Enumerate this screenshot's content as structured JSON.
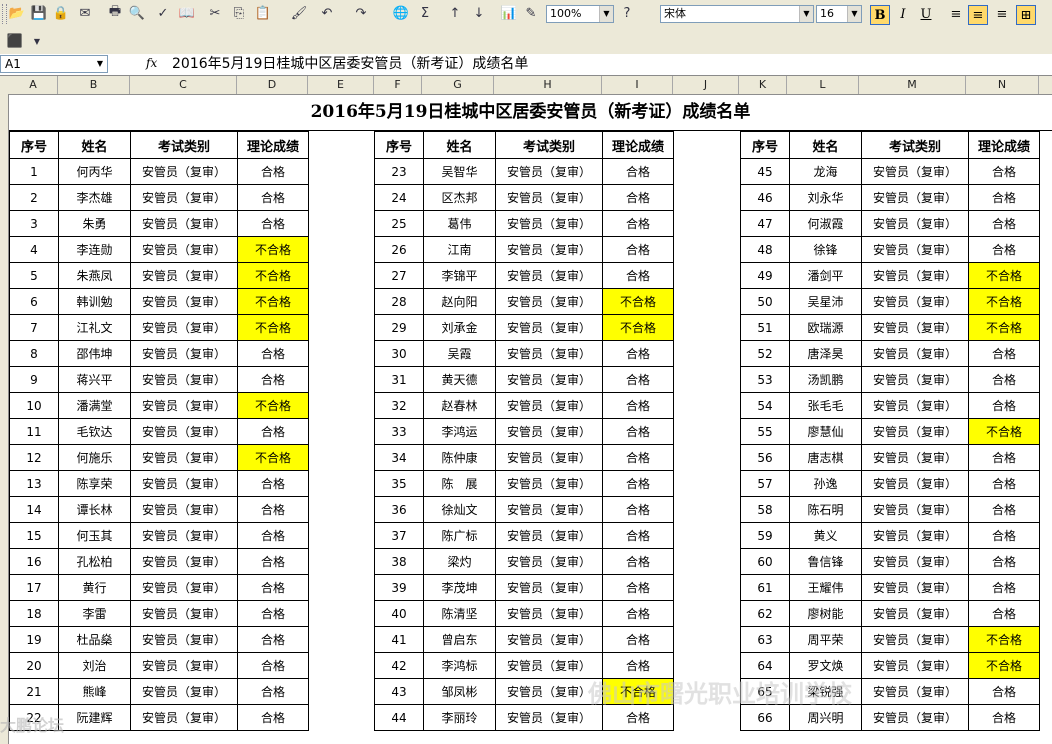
{
  "toolbar": {
    "zoom": "100%",
    "font_name": "宋体",
    "font_size": "16"
  },
  "formula_bar": {
    "cell_ref": "A1",
    "fx_label": "fx",
    "content": "2016年5月19日桂城中区居委安管员（新考证）成绩名单"
  },
  "columns": [
    "A",
    "B",
    "C",
    "D",
    "E",
    "F",
    "G",
    "H",
    "I",
    "J",
    "K",
    "L",
    "M",
    "N"
  ],
  "sheet": {
    "title": "2016年5月19日桂城中区居委安管员（新考证）成绩名单",
    "headers": [
      "序号",
      "姓名",
      "考试类别",
      "理论成绩"
    ],
    "blocks": [
      [
        [
          "1",
          "何丙华",
          "安管员（复审）",
          "合格"
        ],
        [
          "2",
          "李杰雄",
          "安管员（复审）",
          "合格"
        ],
        [
          "3",
          "朱勇",
          "安管员（复审）",
          "合格"
        ],
        [
          "4",
          "李连勋",
          "安管员（复审）",
          "不合格"
        ],
        [
          "5",
          "朱燕凤",
          "安管员（复审）",
          "不合格"
        ],
        [
          "6",
          "韩训勉",
          "安管员（复审）",
          "不合格"
        ],
        [
          "7",
          "江礼文",
          "安管员（复审）",
          "不合格"
        ],
        [
          "8",
          "邵伟坤",
          "安管员（复审）",
          "合格"
        ],
        [
          "9",
          "蒋兴平",
          "安管员（复审）",
          "合格"
        ],
        [
          "10",
          "潘满堂",
          "安管员（复审）",
          "不合格"
        ],
        [
          "11",
          "毛钦达",
          "安管员（复审）",
          "合格"
        ],
        [
          "12",
          "何施乐",
          "安管员（复审）",
          "不合格"
        ],
        [
          "13",
          "陈享荣",
          "安管员（复审）",
          "合格"
        ],
        [
          "14",
          "谭长林",
          "安管员（复审）",
          "合格"
        ],
        [
          "15",
          "何玉其",
          "安管员（复审）",
          "合格"
        ],
        [
          "16",
          "孔松柏",
          "安管员（复审）",
          "合格"
        ],
        [
          "17",
          "黄行",
          "安管员（复审）",
          "合格"
        ],
        [
          "18",
          "李雷",
          "安管员（复审）",
          "合格"
        ],
        [
          "19",
          "杜品燊",
          "安管员（复审）",
          "合格"
        ],
        [
          "20",
          "刘治",
          "安管员（复审）",
          "合格"
        ],
        [
          "21",
          "熊峰",
          "安管员（复审）",
          "合格"
        ],
        [
          "22",
          "阮建辉",
          "安管员（复审）",
          "合格"
        ]
      ],
      [
        [
          "23",
          "吴智华",
          "安管员（复审）",
          "合格"
        ],
        [
          "24",
          "区杰邦",
          "安管员（复审）",
          "合格"
        ],
        [
          "25",
          "葛伟",
          "安管员（复审）",
          "合格"
        ],
        [
          "26",
          "江南",
          "安管员（复审）",
          "合格"
        ],
        [
          "27",
          "李锦平",
          "安管员（复审）",
          "合格"
        ],
        [
          "28",
          "赵向阳",
          "安管员（复审）",
          "不合格"
        ],
        [
          "29",
          "刘承金",
          "安管员（复审）",
          "不合格"
        ],
        [
          "30",
          "吴霞",
          "安管员（复审）",
          "合格"
        ],
        [
          "31",
          "黄天德",
          "安管员（复审）",
          "合格"
        ],
        [
          "32",
          "赵春林",
          "安管员（复审）",
          "合格"
        ],
        [
          "33",
          "李鸿运",
          "安管员（复审）",
          "合格"
        ],
        [
          "34",
          "陈仲康",
          "安管员（复审）",
          "合格"
        ],
        [
          "35",
          "陈　展",
          "安管员（复审）",
          "合格"
        ],
        [
          "36",
          "徐灿文",
          "安管员（复审）",
          "合格"
        ],
        [
          "37",
          "陈广标",
          "安管员（复审）",
          "合格"
        ],
        [
          "38",
          "梁灼",
          "安管员（复审）",
          "合格"
        ],
        [
          "39",
          "李茂坤",
          "安管员（复审）",
          "合格"
        ],
        [
          "40",
          "陈清坚",
          "安管员（复审）",
          "合格"
        ],
        [
          "41",
          "曾启东",
          "安管员（复审）",
          "合格"
        ],
        [
          "42",
          "李鸿标",
          "安管员（复审）",
          "合格"
        ],
        [
          "43",
          "邹凤彬",
          "安管员（复审）",
          "不合格"
        ],
        [
          "44",
          "李丽玲",
          "安管员（复审）",
          "合格"
        ]
      ],
      [
        [
          "45",
          "龙海",
          "安管员（复审）",
          "合格"
        ],
        [
          "46",
          "刘永华",
          "安管员（复审）",
          "合格"
        ],
        [
          "47",
          "何淑霞",
          "安管员（复审）",
          "合格"
        ],
        [
          "48",
          "徐锋",
          "安管员（复审）",
          "合格"
        ],
        [
          "49",
          "潘剑平",
          "安管员（复审）",
          "不合格"
        ],
        [
          "50",
          "吴星沛",
          "安管员（复审）",
          "不合格"
        ],
        [
          "51",
          "欧瑞源",
          "安管员（复审）",
          "不合格"
        ],
        [
          "52",
          "唐泽昊",
          "安管员（复审）",
          "合格"
        ],
        [
          "53",
          "汤凯鹏",
          "安管员（复审）",
          "合格"
        ],
        [
          "54",
          "张毛毛",
          "安管员（复审）",
          "合格"
        ],
        [
          "55",
          "廖慧仙",
          "安管员（复审）",
          "不合格"
        ],
        [
          "56",
          "唐志棋",
          "安管员（复审）",
          "合格"
        ],
        [
          "57",
          "孙逸",
          "安管员（复审）",
          "合格"
        ],
        [
          "58",
          "陈石明",
          "安管员（复审）",
          "合格"
        ],
        [
          "59",
          "黄义",
          "安管员（复审）",
          "合格"
        ],
        [
          "60",
          "鲁信锋",
          "安管员（复审）",
          "合格"
        ],
        [
          "61",
          "王耀伟",
          "安管员（复审）",
          "合格"
        ],
        [
          "62",
          "廖树能",
          "安管员（复审）",
          "合格"
        ],
        [
          "63",
          "周平荣",
          "安管员（复审）",
          "不合格"
        ],
        [
          "64",
          "罗文焕",
          "安管员（复审）",
          "不合格"
        ],
        [
          "65",
          "梁锐强",
          "安管员（复审）",
          "合格"
        ],
        [
          "66",
          "周兴明",
          "安管员（复审）",
          "合格"
        ]
      ]
    ],
    "fail_value": "不合格"
  },
  "watermarks": {
    "school": "佛山市曙光职业培训学校",
    "site": "大鹏论坛"
  }
}
